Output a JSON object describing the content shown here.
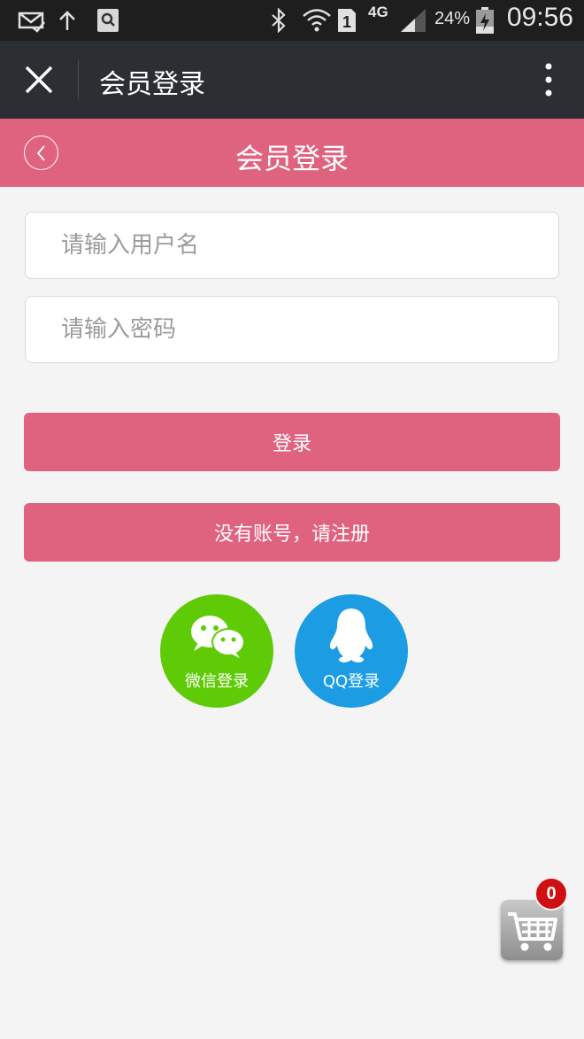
{
  "status_bar": {
    "icons": [
      "mail-check-icon",
      "upload-arrow-icon",
      "search-app-icon",
      "bluetooth-icon",
      "wifi-icon",
      "sim-1-icon",
      "signal-icon",
      "battery-charging-icon"
    ],
    "network": "4G",
    "battery": "24%",
    "time": "09:56"
  },
  "app_bar": {
    "title": "会员登录"
  },
  "header": {
    "title": "会员登录"
  },
  "form": {
    "username_placeholder": "请输入用户名",
    "username_value": "",
    "password_placeholder": "请输入密码",
    "password_value": ""
  },
  "buttons": {
    "login_label": "登录",
    "register_label": "没有账号，请注册"
  },
  "social_login": {
    "wechat_label": "微信登录",
    "qq_label": "QQ登录"
  },
  "cart": {
    "count": "0"
  },
  "colors": {
    "accent": "#df637f",
    "app_bar": "#2b2f33",
    "wechat": "#5ecb06",
    "qq": "#1b9ce3",
    "badge": "#cf0f12"
  }
}
